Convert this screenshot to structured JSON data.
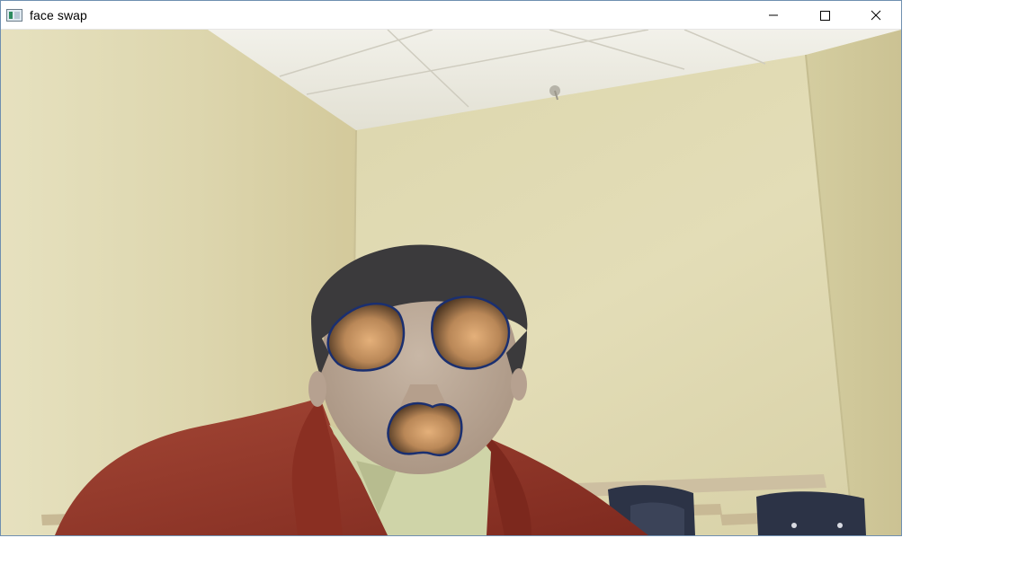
{
  "window": {
    "title": "face swap",
    "icons": {
      "app": "app-window-icon",
      "minimize": "minimize-icon",
      "maximize": "maximize-icon",
      "close": "close-icon"
    }
  },
  "colors": {
    "wall": "#dcd6ad",
    "ceiling": "#efeee6",
    "jacket": "#9a3b2a",
    "swap_patch": "#b98757",
    "patch_outline": "#1a2f70"
  }
}
